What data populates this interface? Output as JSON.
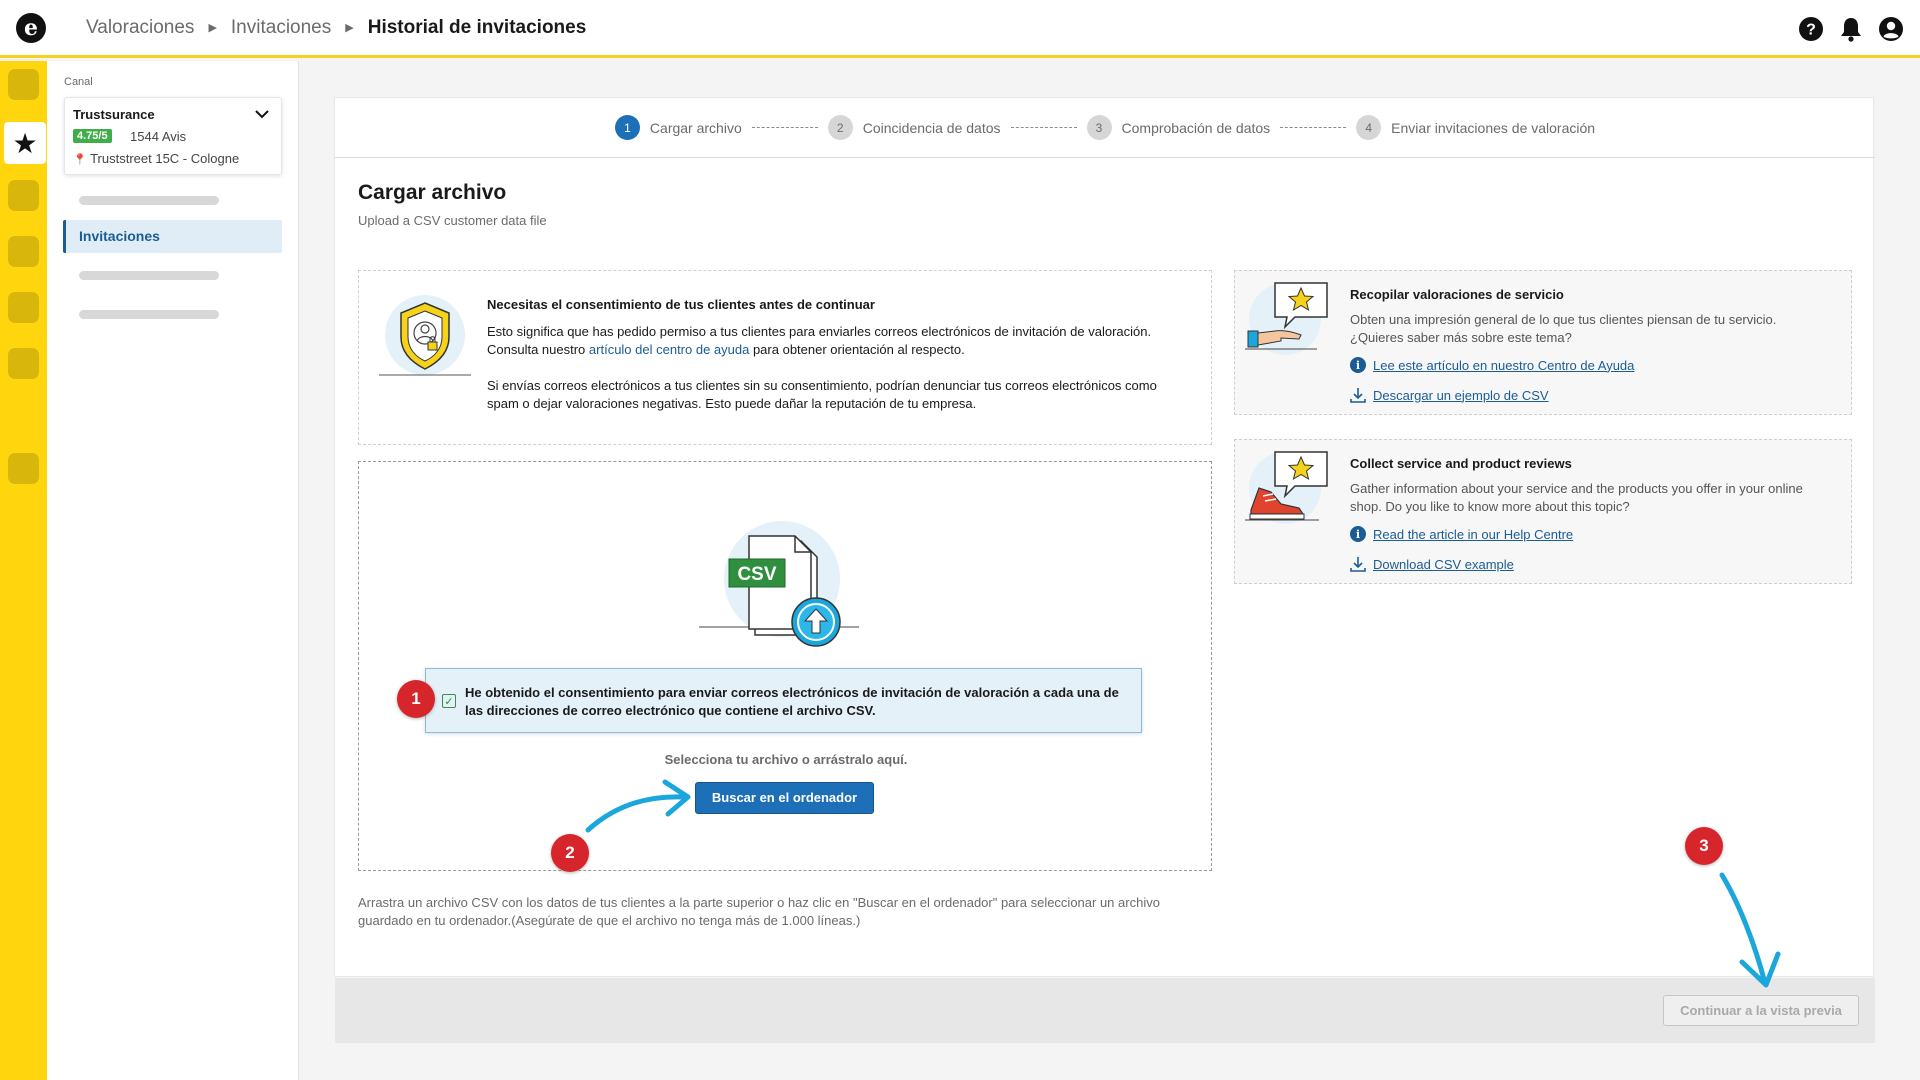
{
  "breadcrumb": {
    "items": [
      "Valoraciones",
      "Invitaciones"
    ],
    "current": "Historial de invitaciones"
  },
  "sidebar": {
    "canal_label": "Canal",
    "channel": {
      "name": "Trustsurance",
      "rating": "4.75/5",
      "reviews": "1544 Avis",
      "address": "Truststreet 15C - Cologne"
    },
    "active_item": "Invitaciones"
  },
  "stepper": [
    {
      "num": "1",
      "label": "Cargar archivo"
    },
    {
      "num": "2",
      "label": "Coincidencia de datos"
    },
    {
      "num": "3",
      "label": "Comprobación de datos"
    },
    {
      "num": "4",
      "label": "Enviar invitaciones de valoración"
    }
  ],
  "page": {
    "title": "Cargar archivo",
    "subtitle": "Upload a CSV customer data file"
  },
  "consent": {
    "title": "Necesitas el consentimiento de tus clientes antes de continuar",
    "p1_before": "Esto significa que has pedido permiso a tus clientes para enviarles correos electrónicos de invitación de valoración. Consulta nuestro ",
    "p1_link": "artículo del centro de ayuda",
    "p1_after": " para obtener orientación al respecto.",
    "p2": "Si envías correos electrónicos a tus clientes sin su consentimiento, podrían denunciar tus correos electrónicos como spam o dejar valoraciones negativas. Esto puede dañar la reputación de tu empresa."
  },
  "dropzone": {
    "csv_badge": "CSV",
    "confirm_text": "He obtenido el consentimiento para enviar correos electrónicos de invitación de valoración a cada una de las direcciones de correo electrónico que contiene el archivo CSV.",
    "confirm_checked": true,
    "hint": "Selecciona tu archivo o arrástralo aquí.",
    "browse_button": "Buscar en el ordenador"
  },
  "drag_note": "Arrastra un archivo CSV con los datos de tus clientes a la parte superior o haz clic en \"Buscar en el ordenador\" para seleccionar un archivo guardado en tu ordenador.(Asegúrate de que el archivo no tenga más de 1.000 líneas.)",
  "info_cards": [
    {
      "title": "Recopilar valoraciones de servicio",
      "desc": "Obten una impresión general de lo que tus clientes piensan de tu servicio. ¿Quieres saber más sobre este tema?",
      "link_help": "Lee este artículo en nuestro Centro de Ayuda",
      "link_csv": "Descargar un ejemplo de CSV"
    },
    {
      "title": "Collect service and product reviews",
      "desc": "Gather information about your service and the products you offer in your online shop. Do you like to know more about this topic?",
      "link_help": "Read the article in our Help Centre",
      "link_csv": "Download CSV example"
    }
  ],
  "footer": {
    "continue_button": "Continuar a la vista previa"
  },
  "annotations": [
    "1",
    "2",
    "3"
  ],
  "colors": {
    "brand_yellow": "#ffd50e",
    "primary_blue": "#1d6fb8",
    "marker_red": "#d6262b",
    "arrow_cyan": "#1ba6dc",
    "rating_green": "#3fae49"
  }
}
